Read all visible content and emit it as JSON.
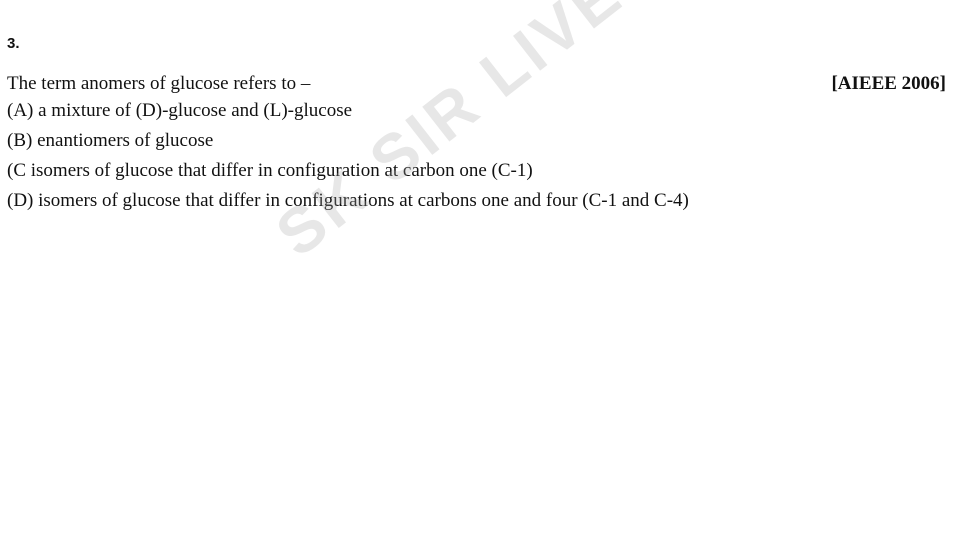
{
  "question": {
    "number": "3.",
    "stem": "The term anomers of glucose refers to –",
    "source": "[AIEEE 2006]",
    "options": [
      "(A) a mixture of (D)-glucose and (L)-glucose",
      "(B) enantiomers of glucose",
      "(C isomers of glucose that differ in configuration at carbon one (C-1)",
      "(D) isomers of glucose that differ in configurations at carbons one and four (C-1 and C-4)"
    ]
  },
  "watermark": {
    "text": "SK SIR LIVE"
  }
}
